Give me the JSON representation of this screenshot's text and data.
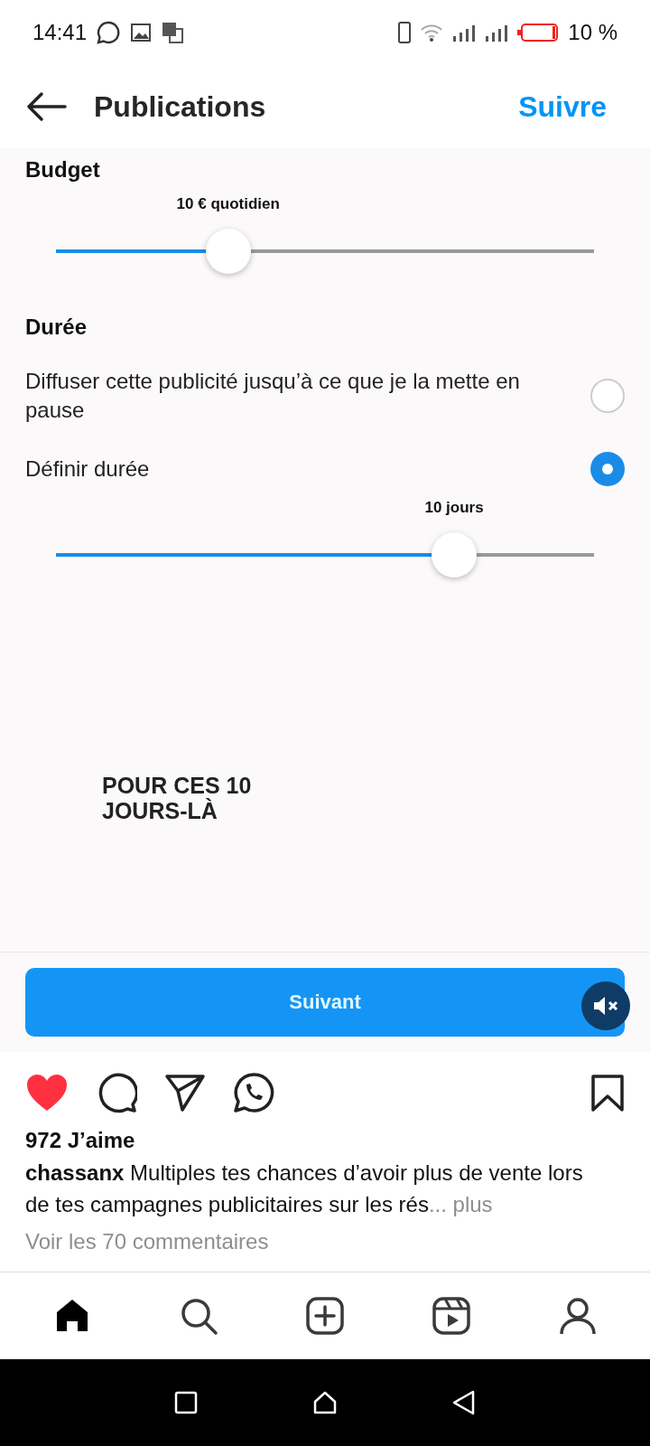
{
  "status_bar": {
    "time": "14:41",
    "battery": "10 %"
  },
  "header": {
    "title": "Publications",
    "follow": "Suivre"
  },
  "video": {
    "budget_heading": "Budget",
    "budget_slider": {
      "reading": "10 € quotidien",
      "level": 0.32
    },
    "duration_heading": "Durée",
    "options": [
      {
        "label": "Diffuser cette publicité jusqu’à ce que je la mette en pause",
        "selected": false
      },
      {
        "label": "Définir durée",
        "selected": true
      }
    ],
    "duration_slider": {
      "reading": "10 jours",
      "level": 0.74
    },
    "caption": "POUR CES 10 JOURS-LÀ",
    "next_button": "Suivant",
    "muted": true
  },
  "post": {
    "liked": true,
    "saved": false,
    "likes": "972 J’aime",
    "caption": "**chassanx** Multiples tes chances d’avoir plus de vente lors de tes campagnes publicitaires sur les rés",
    "more": "... plus",
    "comments": "Voir les 70 commentaires"
  },
  "nav": [
    {
      "kind": "home",
      "selected": true
    },
    {
      "kind": "search",
      "selected": false
    },
    {
      "kind": "create",
      "selected": false
    },
    {
      "kind": "reels",
      "selected": false
    },
    {
      "kind": "profile",
      "selected": false
    }
  ]
}
